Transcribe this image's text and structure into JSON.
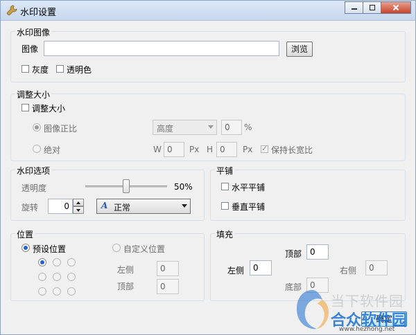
{
  "window": {
    "title": "水印设置",
    "controls": [
      "minimize",
      "maximize",
      "close"
    ]
  },
  "image_group": {
    "title": "水印图像",
    "image_label": "图像",
    "image_value": "",
    "browse_label": "浏览",
    "grayscale_label": "灰度",
    "transparent_color_label": "透明色"
  },
  "resize_group": {
    "title": "调整大小",
    "resize_label": "调整大小",
    "proportional_label": "图像正比",
    "dimension_select": "高度",
    "percent_value": "0",
    "percent_unit": "%",
    "absolute_label": "绝对",
    "w_label": "W",
    "w_value": "0",
    "w_unit": "Px",
    "h_label": "H",
    "h_value": "0",
    "h_unit": "Px",
    "keep_ratio_label": "保持长宽比"
  },
  "options_group": {
    "title": "水印选项",
    "opacity_label": "透明度",
    "opacity_value": "50%",
    "opacity_level": 0.5,
    "rotate_label": "旋转",
    "rotate_value": "0",
    "blend_mode": "正常",
    "blend_icon": "A"
  },
  "tile_group": {
    "title": "平铺",
    "horizontal_label": "水平平铺",
    "vertical_label": "垂直平铺"
  },
  "position_group": {
    "title": "位置",
    "preset_label": "预设位置",
    "custom_label": "自定义位置",
    "left_label": "左侧",
    "left_value": "0",
    "top_label": "顶部",
    "top_value": "0"
  },
  "fill_group": {
    "title": "填充",
    "top_label": "顶部",
    "top_value": "0",
    "left_label": "左侧",
    "left_value": "0",
    "right_label": "右侧",
    "right_value": "0",
    "bottom_label": "底部",
    "bottom_value": "0"
  },
  "footer": {
    "ok_label": "确定"
  },
  "brand_watermark": {
    "line1": "当下软件园",
    "line2": "合众软件园",
    "url": "www.hezhong.net",
    "colors": {
      "primary": "#1b6fd1",
      "secondary": "#f0a030",
      "text": "#555555"
    }
  }
}
